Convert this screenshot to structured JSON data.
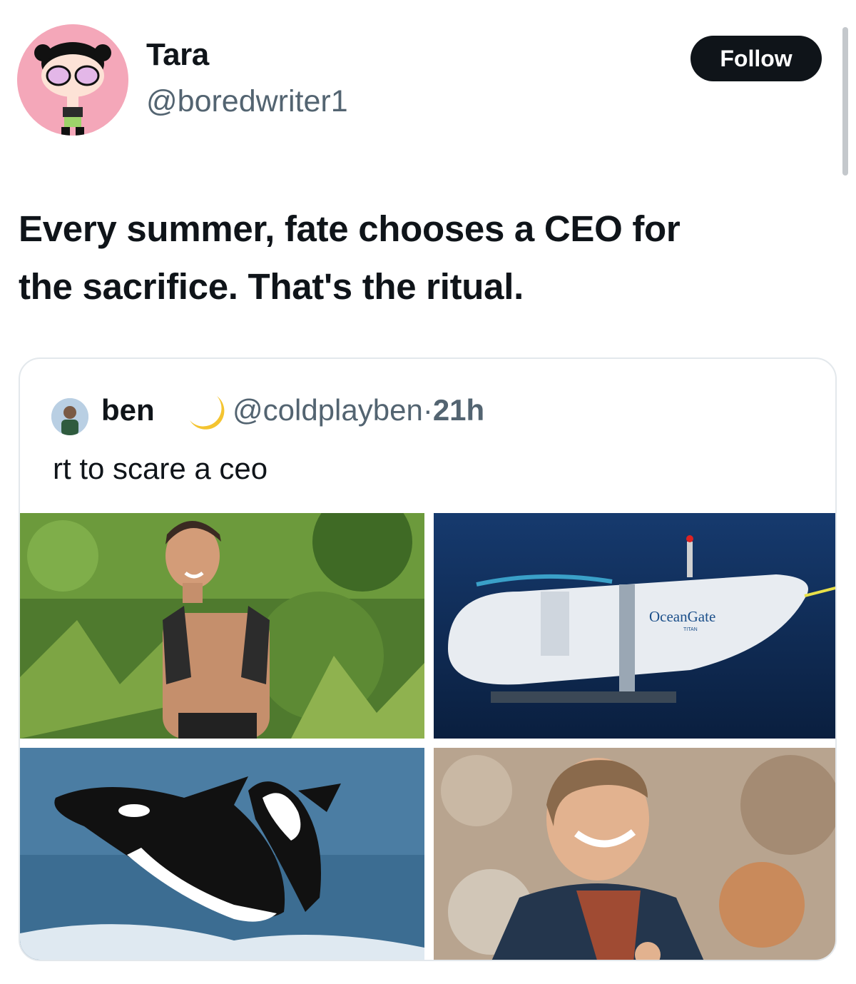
{
  "author": {
    "display_name": "Tara",
    "handle": "@boredwriter1",
    "avatar_icon": "powerpuff-avatar-icon"
  },
  "follow_label": "Follow",
  "tweet_text_line1": "Every summer, fate chooses a CEO for",
  "tweet_text_line2": "the sacrifice. That's the ritual.",
  "quote": {
    "display_name": "ben",
    "emoji": "moon-icon",
    "handle": "@coldplayben",
    "separator": "·",
    "time": "21h",
    "text": "rt to scare a ceo",
    "images": [
      "shirtless-hiker-photo",
      "oceangate-submersible-photo",
      "orca-whales-photo",
      "smiling-singer-photo"
    ],
    "sub_logo_text": "OceanGate",
    "sub_logo_subtext": "TITAN"
  },
  "colors": {
    "text": "#0f1419",
    "secondary": "#536471",
    "follow_bg": "#0f1419",
    "avatar_bg": "#f4a7b9",
    "border": "#e3e8ec"
  }
}
